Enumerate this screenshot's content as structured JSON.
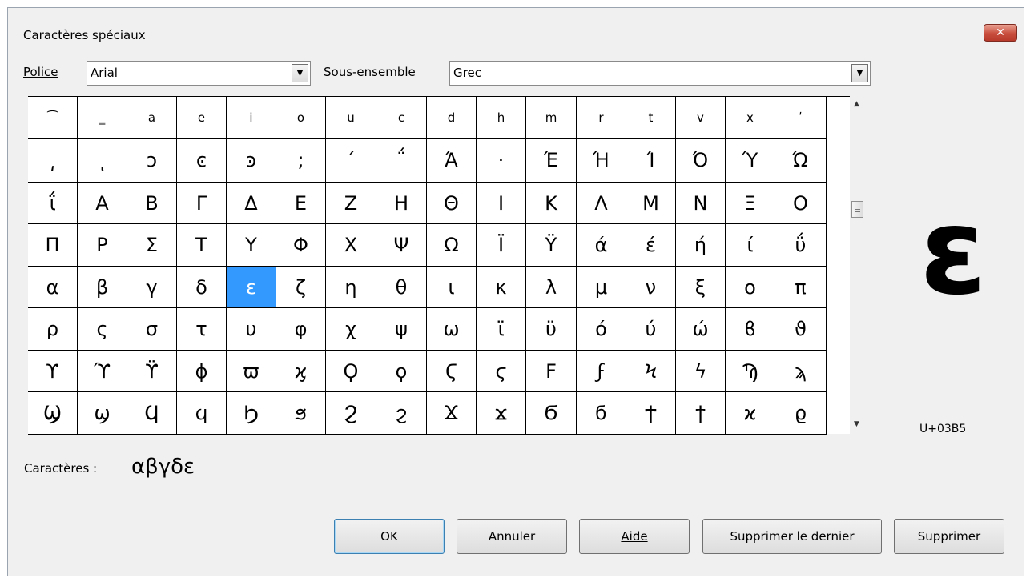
{
  "window": {
    "title": "Caractères spéciaux",
    "close_glyph": "✕"
  },
  "font": {
    "label": "Police",
    "value": "Arial"
  },
  "subset": {
    "label": "Sous-ensemble",
    "value": "Grec"
  },
  "grid": {
    "rows": [
      [
        "⁀",
        "‗",
        "a",
        "e",
        "i",
        "o",
        "u",
        "c",
        "d",
        "h",
        "m",
        "r",
        "t",
        "v",
        "x",
        "ʹ"
      ],
      [
        "͵",
        "ͺ",
        "ͻ",
        "ͼ",
        "ͽ",
        ";",
        "΄",
        "΅",
        "Ά",
        "·",
        "Έ",
        "Ή",
        "Ί",
        "Ό",
        "Ύ",
        "Ώ"
      ],
      [
        "ΐ",
        "Α",
        "Β",
        "Γ",
        "Δ",
        "Ε",
        "Ζ",
        "Η",
        "Θ",
        "Ι",
        "Κ",
        "Λ",
        "Μ",
        "Ν",
        "Ξ",
        "Ο"
      ],
      [
        "Π",
        "Ρ",
        "Σ",
        "Τ",
        "Υ",
        "Φ",
        "Χ",
        "Ψ",
        "Ω",
        "Ϊ",
        "Ϋ",
        "ά",
        "έ",
        "ή",
        "ί",
        "ΰ"
      ],
      [
        "α",
        "β",
        "γ",
        "δ",
        "ε",
        "ζ",
        "η",
        "θ",
        "ι",
        "κ",
        "λ",
        "μ",
        "ν",
        "ξ",
        "ο",
        "π"
      ],
      [
        "ρ",
        "ς",
        "σ",
        "τ",
        "υ",
        "φ",
        "χ",
        "ψ",
        "ω",
        "ϊ",
        "ϋ",
        "ό",
        "ύ",
        "ώ",
        "ϐ",
        "ϑ"
      ],
      [
        "ϒ",
        "ϓ",
        "ϔ",
        "ϕ",
        "ϖ",
        "ϗ",
        "Ϙ",
        "ϙ",
        "Ϛ",
        "ϛ",
        "Ϝ",
        "ϝ",
        "Ϟ",
        "ϟ",
        "Ϡ",
        "ϡ"
      ],
      [
        "Ϣ",
        "ϣ",
        "Ϥ",
        "ϥ",
        "Ϧ",
        "ϧ",
        "Ϩ",
        "ϩ",
        "Ϫ",
        "ϫ",
        "Ϭ",
        "ϭ",
        "Ϯ",
        "ϯ",
        "ϰ",
        "ϱ"
      ]
    ],
    "selected": {
      "row": 4,
      "col": 4
    }
  },
  "preview": {
    "char": "ε",
    "code": "U+03B5"
  },
  "characters": {
    "label": "Caractères :",
    "value": "αβγδε"
  },
  "buttons": {
    "ok": "OK",
    "cancel": "Annuler",
    "help": "Aide",
    "delete_last": "Supprimer le dernier",
    "delete": "Supprimer"
  },
  "scrollbar": {
    "up_arrow": "▲",
    "down_arrow": "▼"
  },
  "icons": {
    "dropdown": "chevron-down-icon",
    "close": "close-icon"
  }
}
